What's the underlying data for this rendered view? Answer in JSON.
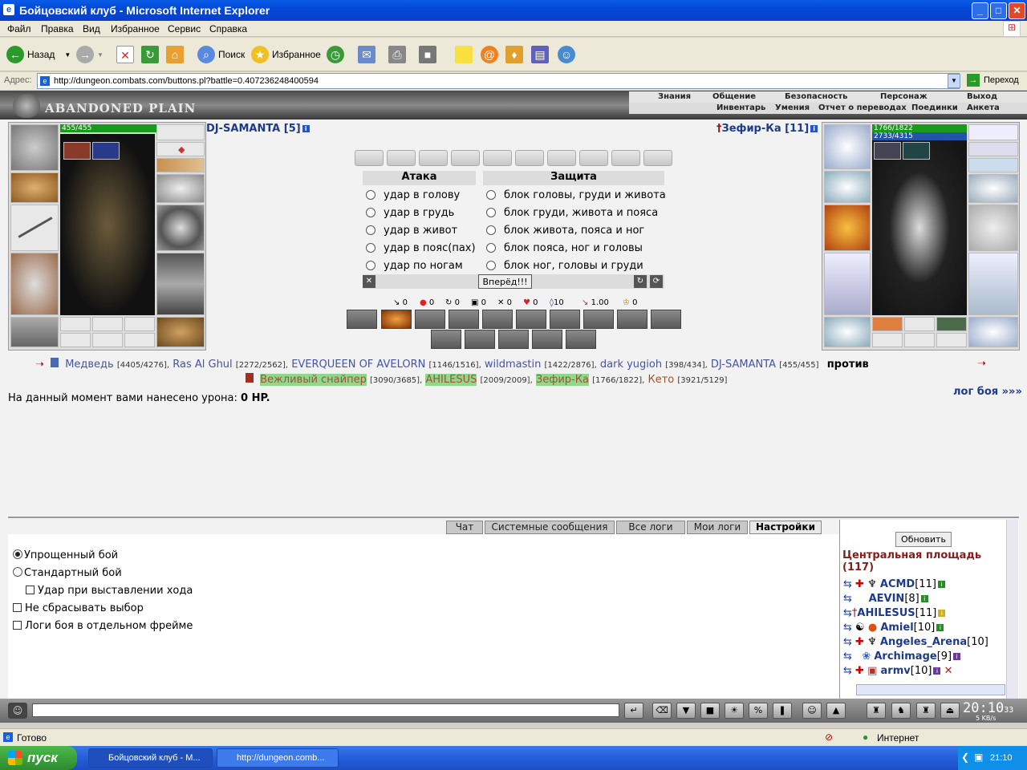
{
  "window": {
    "title": "Бойцовский клуб - Microsoft Internet Explorer",
    "min": "_",
    "max": "□",
    "close": "✕"
  },
  "menu": [
    "Файл",
    "Правка",
    "Вид",
    "Избранное",
    "Сервис",
    "Справка"
  ],
  "toolbar": {
    "back": "Назад",
    "search": "Поиск",
    "favorites": "Избранное"
  },
  "address": {
    "label": "Адрес:",
    "url": "http://dungeon.combats.com/buttons.pl?battle=0.407236248400594",
    "go": "Переход"
  },
  "game": {
    "location": "ABANDONED PLAIN",
    "nav_top": [
      "Знания",
      "Общение",
      "Безопасность",
      "Персонаж",
      "Выход"
    ],
    "nav_bottom": [
      "Инвентарь",
      "Умения",
      "Отчет о переводах",
      "Поединки",
      "Анкета"
    ],
    "left_player": {
      "name": "DJ-SAMANTA [5]",
      "hp": "455/455"
    },
    "right_player": {
      "name": "Зефир-Ка [11]",
      "hp": "1766/1822",
      "mp": "2733/4315"
    },
    "attack_title": "Атака",
    "defense_title": "Защита",
    "attacks": [
      "удар в голову",
      "удар в грудь",
      "удар в живот",
      "удар в пояс(пах)",
      "удар по ногам"
    ],
    "blocks": [
      "блок головы, груди и живота",
      "блок груди, живота и пояса",
      "блок живота, пояса и ног",
      "блок пояса, ног и головы",
      "блок ног, головы и груди"
    ],
    "forward_button": "Вперёд!!!",
    "stats": [
      "0",
      "0",
      "0",
      "0",
      "0",
      "0",
      "10",
      "1.00",
      "0"
    ],
    "team1": [
      {
        "name": "Медведь",
        "hp": "[4405/4276],"
      },
      {
        "name": "Ras Al Ghul",
        "hp": "[2272/2562],"
      },
      {
        "name": "EVERQUEEN OF AVELORN",
        "hp": "[1146/1516],"
      },
      {
        "name": "wildmastin",
        "hp": "[1422/2876],"
      },
      {
        "name": "dark yugioh",
        "hp": "[398/434],"
      },
      {
        "name": "DJ-SAMANTA",
        "hp": "[455/455]"
      }
    ],
    "versus": "против",
    "team2": [
      {
        "name": "Вежливый снайпер",
        "hp": "[3090/3685],"
      },
      {
        "name": "AHILESUS",
        "hp": "[2009/2009],"
      },
      {
        "name": "Зефир-Ка",
        "hp": "[1766/1822],"
      },
      {
        "name": "Кето",
        "hp": "[3921/5129]"
      }
    ],
    "damage_text": "На данный момент вами нанесено урона:",
    "damage_value": "0 HP.",
    "log_link": "лог боя »»»"
  },
  "tabs": [
    "Чат",
    "Системные сообщения",
    "Все логи",
    "Мои логи",
    "Настройки"
  ],
  "settings": [
    "Упрощенный бой",
    "Стандартный бой",
    "Удар при выставлении хода",
    "Не сбрасывать выбор",
    "Логи боя в отдельном фрейме"
  ],
  "room": {
    "refresh": "Обновить",
    "title": "Центральная площадь",
    "count": "(117)",
    "users": [
      {
        "name": "ACMD",
        "level": "[11]"
      },
      {
        "name": "AEVIN",
        "level": "[8]"
      },
      {
        "name": "AHILESUS",
        "level": "[11]"
      },
      {
        "name": "Amiel",
        "level": "[10]"
      },
      {
        "name": "Angeles_Arena",
        "level": "[10]"
      },
      {
        "name": "Archimage",
        "level": "[9]"
      },
      {
        "name": "armv",
        "level": "[10]"
      }
    ]
  },
  "chat": {
    "clock": "20:10",
    "seconds": "33",
    "kbs": "5 KB/s"
  },
  "status": {
    "ready": "Готово",
    "zone": "Интернет"
  },
  "taskbar": {
    "start": "пуск",
    "tasks": [
      "Бойцовский клуб - M...",
      "http://dungeon.comb..."
    ],
    "time": "21:10"
  }
}
